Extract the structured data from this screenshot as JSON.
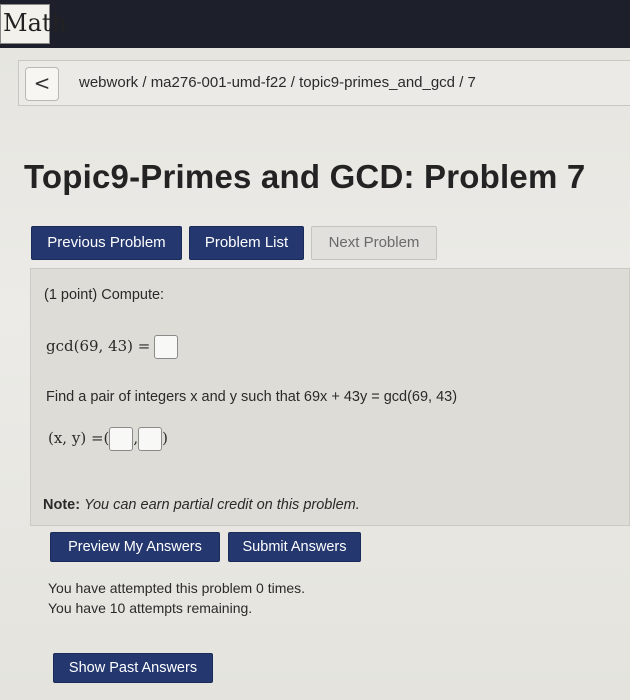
{
  "header": {
    "brand": "Math"
  },
  "breadcrumb": {
    "back_label": "<",
    "path": "webwork / ma276-001-umd-f22 / topic9-primes_and_gcd / 7"
  },
  "page_title": "Topic9-Primes and GCD: Problem 7",
  "nav": {
    "previous": "Previous Problem",
    "list": "Problem List",
    "next": "Next Problem"
  },
  "problem": {
    "intro": "(1 point) Compute:",
    "gcd_expr": "gcd(69, 43) =",
    "pair_prompt": "Find a pair of integers x and y such that 69x + 43y = gcd(69, 43)",
    "pair_expr_left": "(x, y) =(",
    "pair_comma": ",",
    "pair_close": ")",
    "answers": {
      "gcd": "",
      "x": "",
      "y": ""
    }
  },
  "note": {
    "label": "Note:",
    "text": "You can earn partial credit on this problem."
  },
  "actions": {
    "preview": "Preview My Answers",
    "submit": "Submit Answers"
  },
  "attempts": {
    "line1": "You have attempted this problem 0 times.",
    "line2": "You have 10 attempts remaining."
  },
  "past_answers": "Show Past Answers",
  "colors": {
    "button_primary": "#24386f",
    "top_bar": "#1d1f2b"
  }
}
